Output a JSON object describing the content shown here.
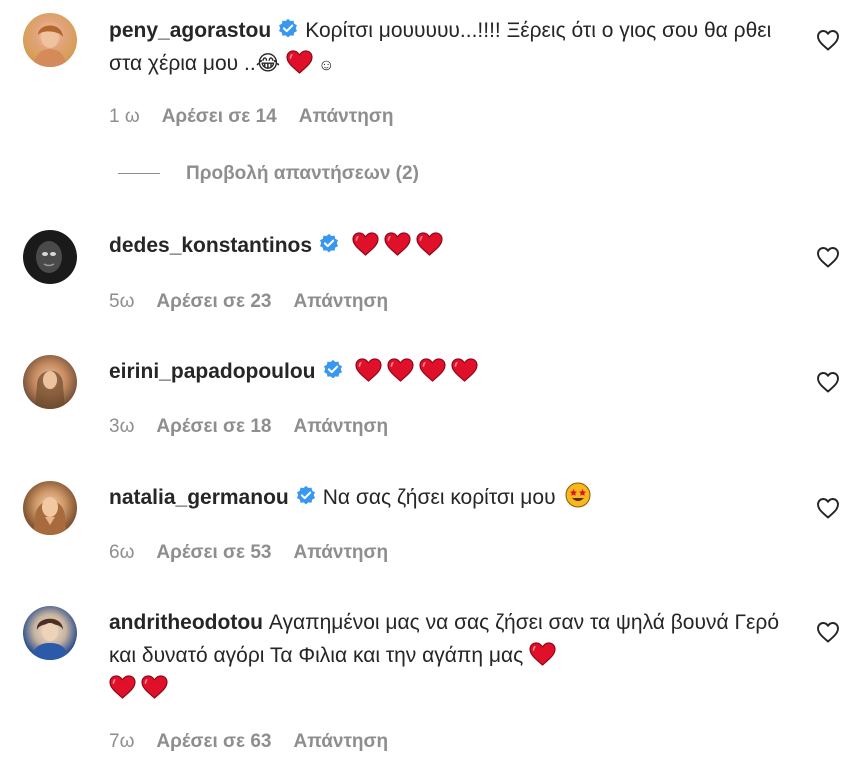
{
  "comments": [
    {
      "username": "peny_agorastou",
      "text": "Κορίτσι μουυυυυ...!!!! Ξέρεις ότι ο γιος σου θα ρθει στα χέρια μου ..😂",
      "trail": "☺",
      "time": "1 ω",
      "likes": "Αρέσει σε 14",
      "reply": "Απάντηση"
    },
    {
      "username": "dedes_konstantinos",
      "time": "5ω",
      "likes": "Αρέσει σε 23",
      "reply": "Απάντηση"
    },
    {
      "username": "eirini_papadopoulou",
      "time": "3ω",
      "likes": "Αρέσει σε 18",
      "reply": "Απάντηση"
    },
    {
      "username": "natalia_germanou",
      "text": "Να σας ζήσει κορίτσι μου",
      "time": "6ω",
      "likes": "Αρέσει σε 53",
      "reply": "Απάντηση"
    },
    {
      "username": "andritheodotou",
      "text": "Αγαπημένοι μας να σας ζήσει σαν τα ψηλά βουνά Γερό και δυνατό αγόρι Τα Φιλια και την αγάπη μας",
      "time": "7ω",
      "likes": "Αρέσει σε 63",
      "reply": "Απάντηση"
    }
  ],
  "view_replies": "Προβολή απαντήσεων (2)",
  "colors": {
    "heart": "#e0102a",
    "verified": "#3897f0",
    "meta": "#8e8e8e"
  },
  "icons": {
    "like": "heart-outline-icon",
    "verified": "verified-badge-icon"
  }
}
